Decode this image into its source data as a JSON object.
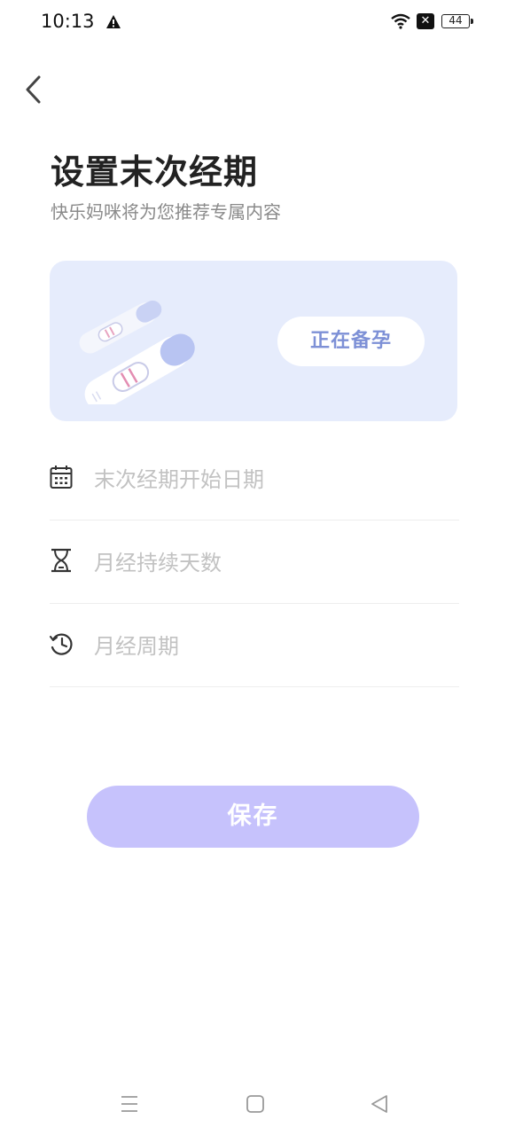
{
  "status_bar": {
    "time": "10:13",
    "battery": "44"
  },
  "header": {
    "back_icon": "chevron-left-icon",
    "title": "设置末次经期",
    "subtitle": "快乐妈咪将为您推荐专属内容"
  },
  "banner": {
    "status_label": "正在备孕"
  },
  "form": {
    "fields": [
      {
        "icon": "calendar-icon",
        "placeholder": "末次经期开始日期"
      },
      {
        "icon": "hourglass-icon",
        "placeholder": "月经持续天数"
      },
      {
        "icon": "clock-cycle-icon",
        "placeholder": "月经周期"
      }
    ]
  },
  "actions": {
    "save_label": "保存"
  },
  "colors": {
    "accent_button": "#c6c2fc",
    "banner_bg": "#e6ecfc",
    "pill_text": "#7d90d6",
    "placeholder_text": "#c2c2c2"
  }
}
